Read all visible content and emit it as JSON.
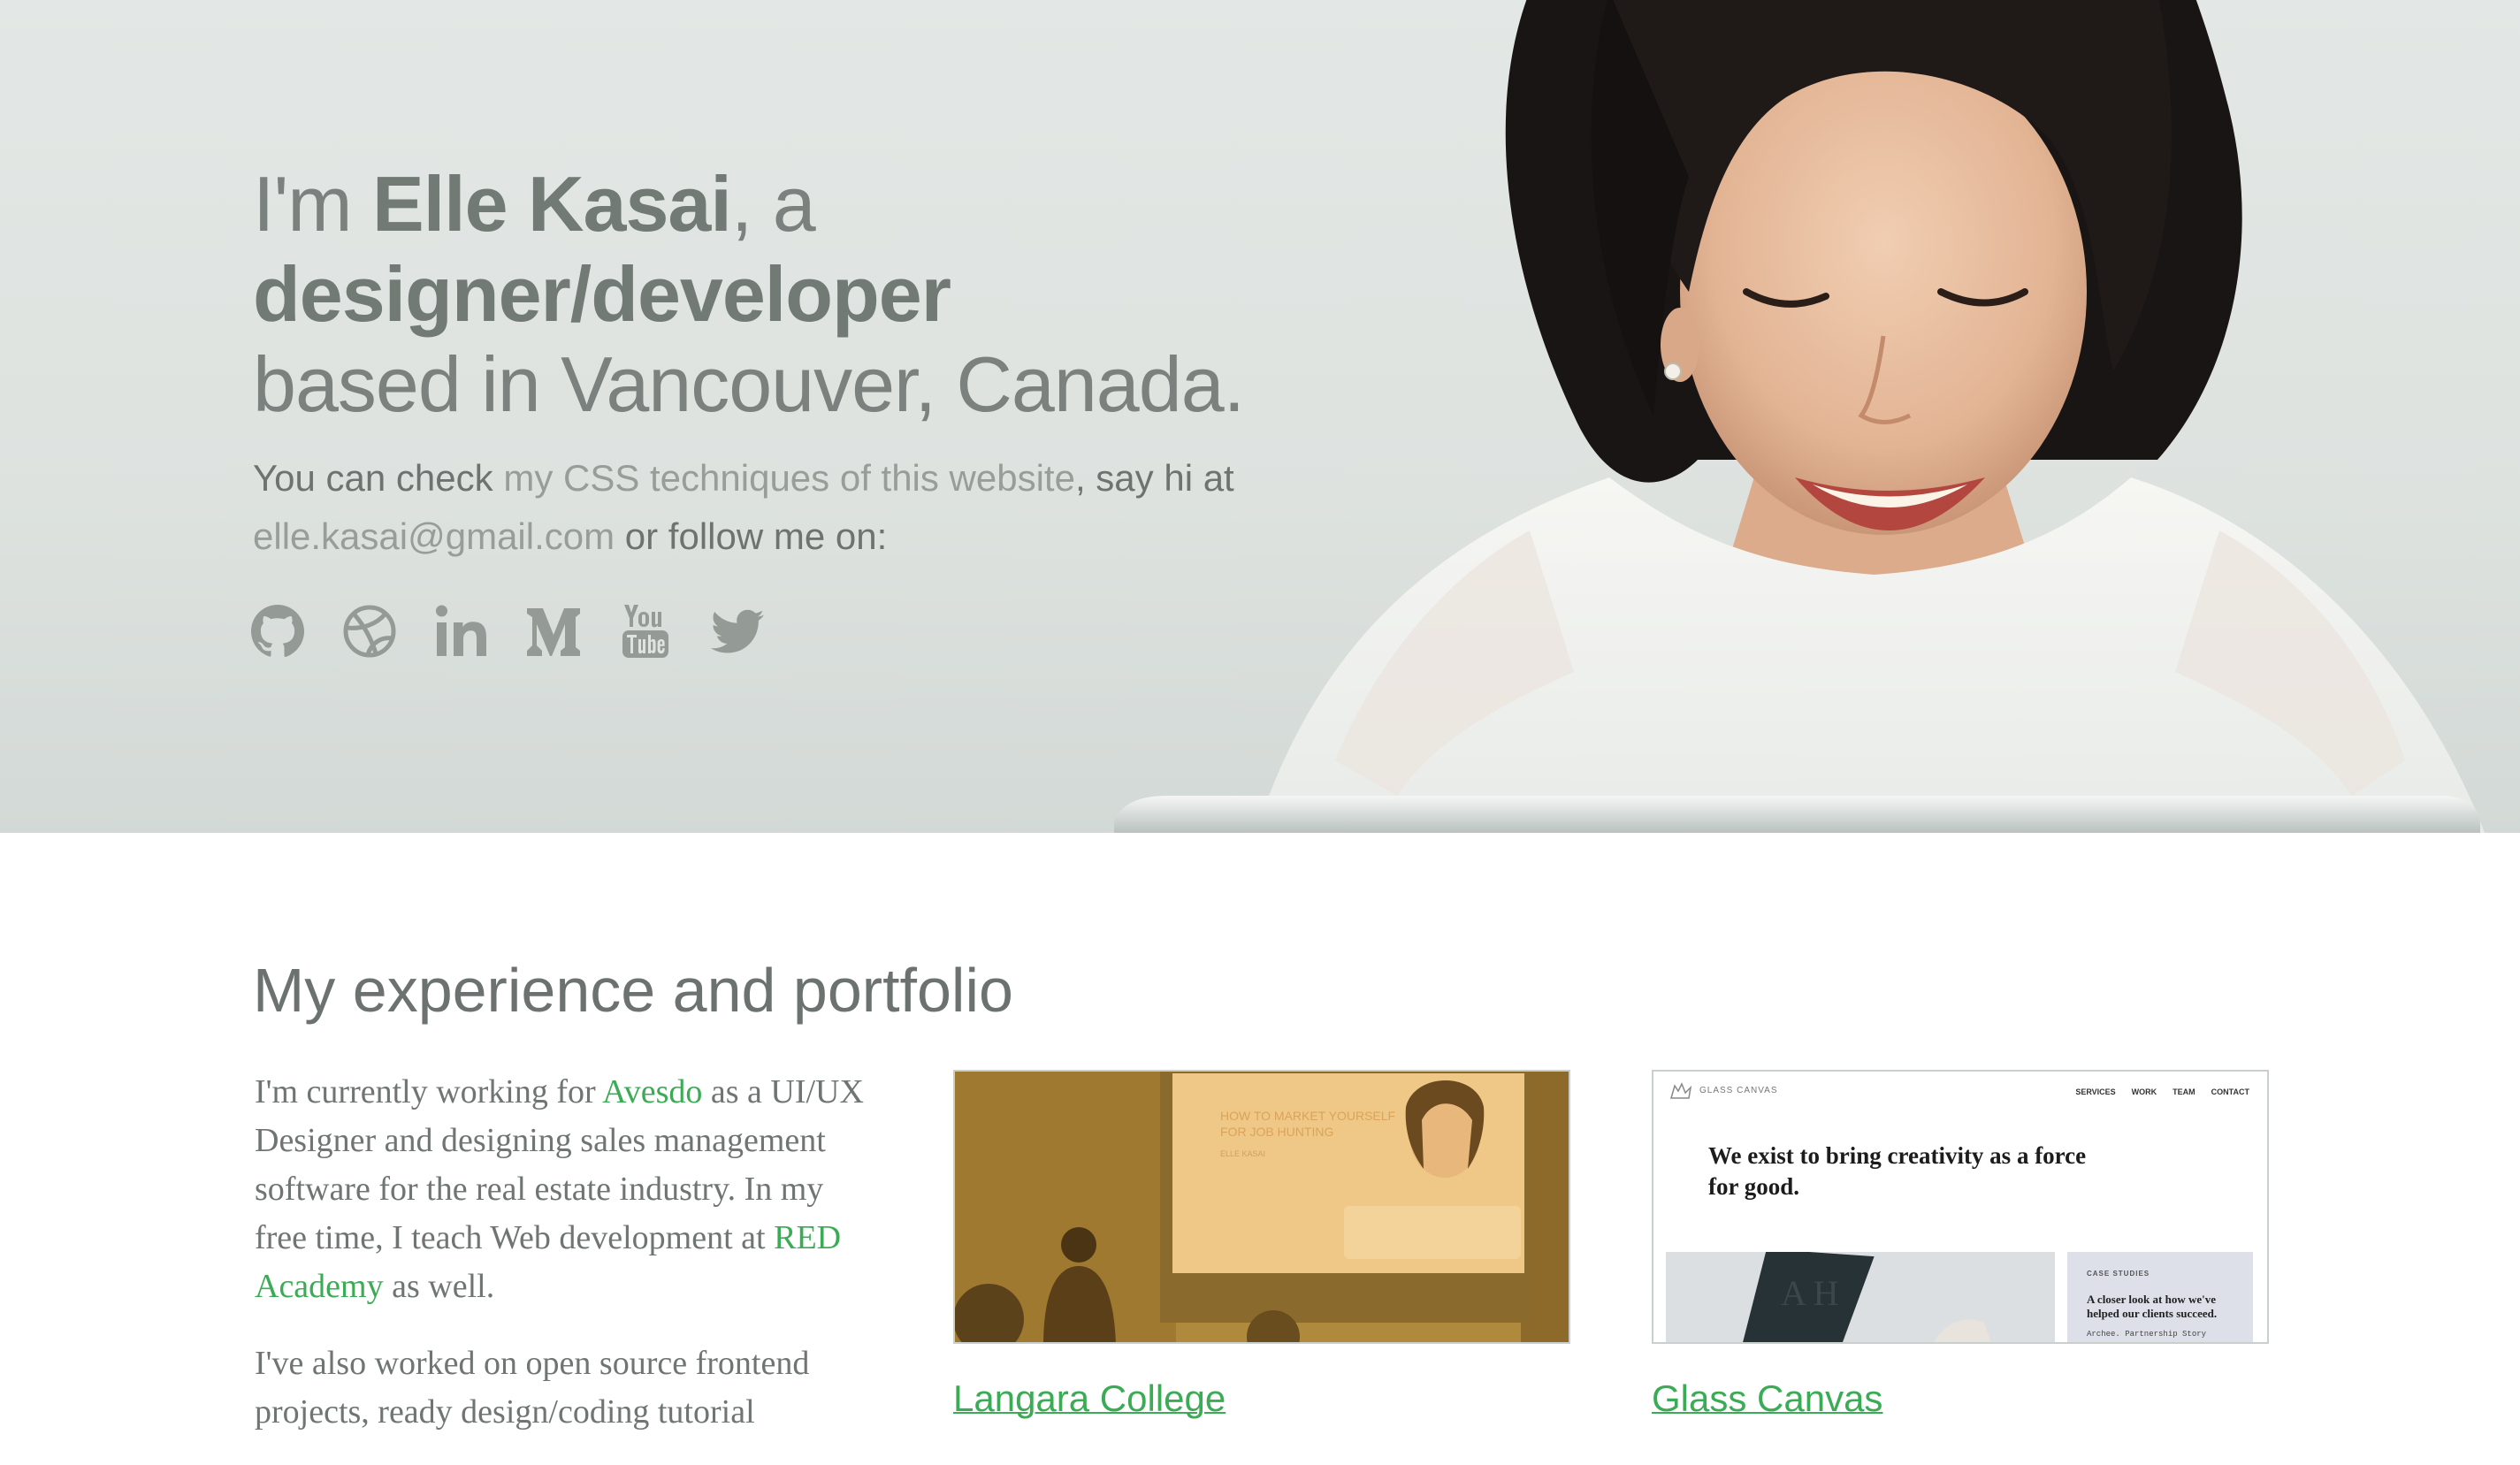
{
  "hero": {
    "headline": {
      "pre": "I'm ",
      "name": "Elle Kasai",
      "mid": ", a ",
      "role": "designer/developer",
      "line2": "based in Vancouver, Canada."
    },
    "intro": {
      "text1": "You can check ",
      "link_css": "my CSS techniques of this website",
      "text2": ", say hi at",
      "email": "elle.kasai@gmail.com",
      "text3": " or follow me on:"
    },
    "social": [
      "github-icon",
      "dribbble-icon",
      "linkedin-icon",
      "medium-icon",
      "youtube-icon",
      "twitter-icon"
    ]
  },
  "portfolio": {
    "title": "My experience and portfolio",
    "about": {
      "p1_a": "I'm currently working for ",
      "p1_link1": "Avesdo",
      "p1_b": " as a UI/UX Designer and designing sales management software for the real estate industry. In my free time, I teach Web development at ",
      "p1_link2": "RED Academy",
      "p1_c": " as well.",
      "p2": "I've also worked on open source frontend projects, ready design/coding tutorial"
    },
    "cards": [
      {
        "title": "Langara College",
        "slide_line1": "HOW TO MARKET YOURSELF",
        "slide_line2": "FOR JOB HUNTING",
        "slide_author": "ELLE KASAI"
      },
      {
        "title": "Glass Canvas",
        "brand": "GLASS CANVAS",
        "nav": [
          "SERVICES",
          "WORK",
          "TEAM",
          "CONTACT"
        ],
        "headline": "We exist to bring creativity as a force for good.",
        "panel_label": "CASE STUDIES",
        "panel_text": "A closer look at how we've helped our clients succeed.",
        "panel_link": "Archee. Partnership Story"
      }
    ]
  },
  "colors": {
    "accent_green": "#3bab55",
    "heading_gray": "#6b726f",
    "hero_bg": "#e0e5e2"
  }
}
